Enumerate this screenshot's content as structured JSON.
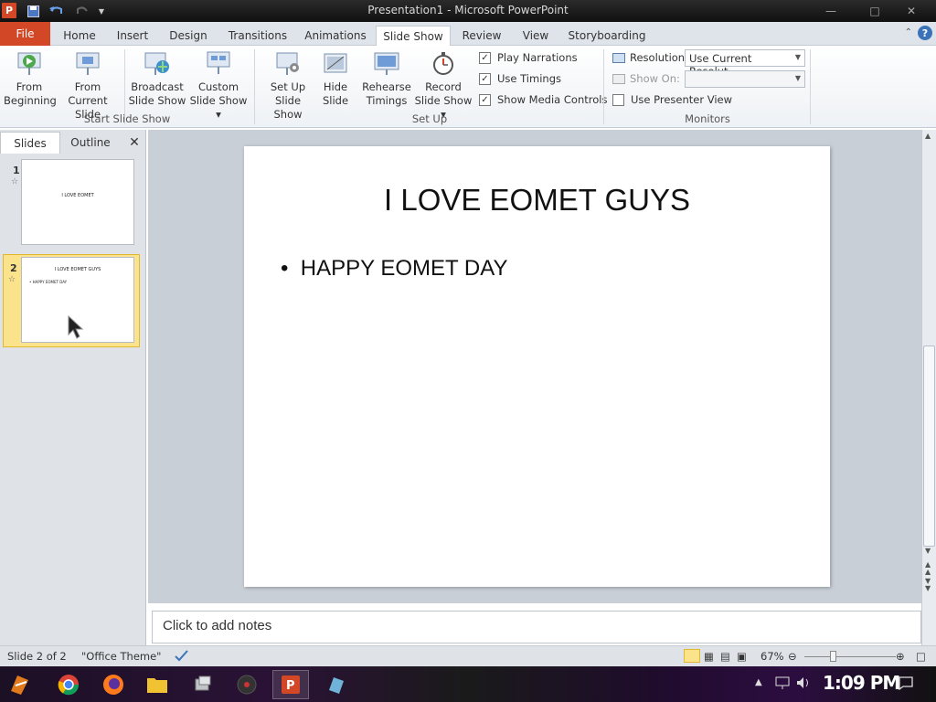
{
  "window": {
    "title": "Presentation1 - Microsoft PowerPoint"
  },
  "tabs": [
    "File",
    "Home",
    "Insert",
    "Design",
    "Transitions",
    "Animations",
    "Slide Show",
    "Review",
    "View",
    "Storyboarding"
  ],
  "active_tab": "Slide Show",
  "ribbon": {
    "start": {
      "from_beginning": [
        "From",
        "Beginning"
      ],
      "from_current": [
        "From Current",
        "Slide"
      ],
      "broadcast": [
        "Broadcast",
        "Slide Show"
      ],
      "custom": [
        "Custom",
        "Slide Show ▾"
      ],
      "label": "Start Slide Show"
    },
    "setup": {
      "setup_show": [
        "Set Up",
        "Slide Show"
      ],
      "hide_slide": [
        "Hide",
        "Slide"
      ],
      "rehearse": [
        "Rehearse",
        "Timings"
      ],
      "record": [
        "Record",
        "Slide Show ▾"
      ],
      "play_narrations": "Play Narrations",
      "use_timings": "Use Timings",
      "show_media_controls": "Show Media Controls",
      "label": "Set Up"
    },
    "monitors": {
      "resolution_label": "Resolution:",
      "resolution_value": "Use Current Resolut...",
      "show_on_label": "Show On:",
      "presenter_view": "Use Presenter View",
      "label": "Monitors"
    }
  },
  "panel": {
    "slides_tab": "Slides",
    "outline_tab": "Outline",
    "close": "✕"
  },
  "thumbnails": [
    {
      "num": "1",
      "title": "I LOVE EOMET"
    },
    {
      "num": "2",
      "title": "I LOVE EOMET GUYS",
      "bullet": "•  HAPPY EOMET  DAY"
    }
  ],
  "slide": {
    "title": "I LOVE EOMET GUYS",
    "bullet": "HAPPY  EOMET DAY"
  },
  "notes": {
    "placeholder": "Click to add notes"
  },
  "status": {
    "slide_info": "Slide 2 of 2",
    "theme": "\"Office Theme\"",
    "zoom": "67%"
  },
  "taskbar": {
    "clock": "1:09 PM"
  },
  "colors": {
    "accent": "#d24726",
    "ribbon_bg": "#ffffff",
    "workspace": "#c9cfd7"
  }
}
